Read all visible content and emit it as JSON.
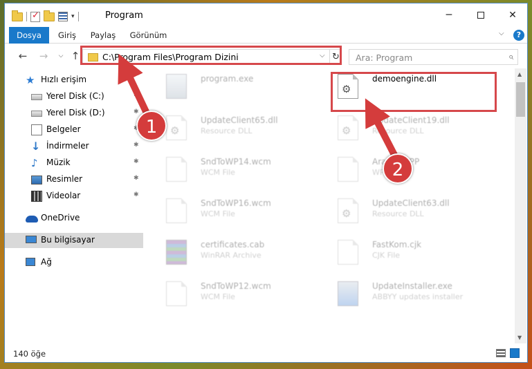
{
  "window": {
    "title": "Program",
    "minimize_label": "─",
    "close_label": "✕"
  },
  "ribbon": {
    "tabs": [
      "Dosya",
      "Giriş",
      "Paylaş",
      "Görünüm"
    ],
    "expand_label": "⌵",
    "help_label": "?"
  },
  "address": {
    "path": "C:\\Program Files\\Program Dizini",
    "dropdown_label": "⌵",
    "refresh_label": "↻"
  },
  "nav_buttons": {
    "back": "←",
    "forward": "→",
    "recent": "⌵",
    "up": "↑"
  },
  "search": {
    "placeholder": "Ara: Program",
    "icon_glyph": "⌕"
  },
  "sidebar": {
    "items": [
      {
        "label": "Hızlı erişim",
        "icon": "star-icon",
        "pinned": false
      },
      {
        "label": "Yerel Disk (C:)",
        "icon": "drive-icon",
        "pinned": true
      },
      {
        "label": "Yerel Disk (D:)",
        "icon": "drive-icon",
        "pinned": true
      },
      {
        "label": "Belgeler",
        "icon": "documents-icon",
        "pinned": true
      },
      {
        "label": "İndirmeler",
        "icon": "download-icon",
        "pinned": true
      },
      {
        "label": "Müzik",
        "icon": "music-icon",
        "pinned": true
      },
      {
        "label": "Resimler",
        "icon": "pictures-icon",
        "pinned": true
      },
      {
        "label": "Videolar",
        "icon": "videos-icon",
        "pinned": true
      },
      {
        "label": "OneDrive",
        "icon": "cloud-icon",
        "pinned": false
      },
      {
        "label": "Bu bilgisayar",
        "icon": "computer-icon",
        "pinned": false
      },
      {
        "label": "Ağ",
        "icon": "network-icon",
        "pinned": false
      }
    ],
    "pin_glyph": "📌"
  },
  "files": [
    {
      "name": "program.exe",
      "type": "",
      "icon": "exe-icon"
    },
    {
      "name": "demoengine.dll",
      "type": "",
      "icon": "dll-gear-icon"
    },
    {
      "name": "UpdateClient65.dll",
      "type": "Resource DLL",
      "icon": "dll-icon"
    },
    {
      "name": "UpdateClient19.dll",
      "type": "Resource DLL",
      "icon": "dll-gear-icon"
    },
    {
      "name": "SndToWP14.wcm",
      "type": "WCM File",
      "icon": "document-icon"
    },
    {
      "name": "Arabic.WPP",
      "type": "WPP File",
      "icon": "document-icon"
    },
    {
      "name": "SndToWP16.wcm",
      "type": "WCM File",
      "icon": "document-icon"
    },
    {
      "name": "UpdateClient63.dll",
      "type": "Resource DLL",
      "icon": "dll-gear-icon"
    },
    {
      "name": "certificates.cab",
      "type": "WinRAR Archive",
      "icon": "archive-icon"
    },
    {
      "name": "FastKom.cjk",
      "type": "CJK File",
      "icon": "document-icon"
    },
    {
      "name": "SndToWP12.wcm",
      "type": "WCM File",
      "icon": "document-icon"
    },
    {
      "name": "UpdateInstaller.exe",
      "type": "ABBYY updates installer",
      "icon": "installer-icon"
    }
  ],
  "status": {
    "item_count": "140 öğe"
  },
  "callouts": {
    "step1": "1",
    "step2": "2"
  },
  "colors": {
    "accent": "#1979ca",
    "highlight": "#d6484b",
    "callout": "#d43c3c"
  }
}
